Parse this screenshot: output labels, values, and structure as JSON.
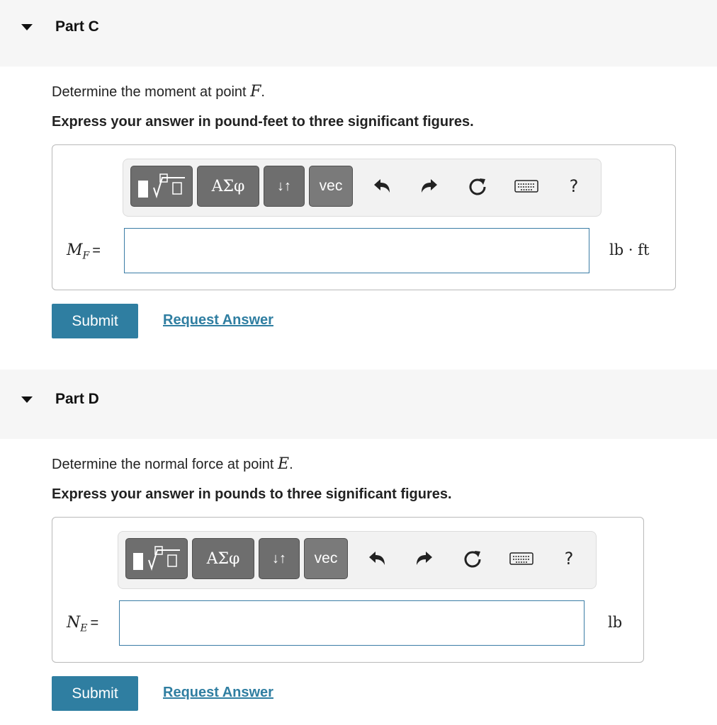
{
  "parts": [
    {
      "title": "Part C",
      "question_prefix": "Determine the moment at point ",
      "question_var": "F",
      "question_suffix": ".",
      "instruction": "Express your answer in pound-feet to three significant figures.",
      "variable": "M",
      "variable_sub": "F",
      "equals": "=",
      "input_value": "",
      "unit": "lb · ft",
      "submit_label": "Submit",
      "request_label": "Request Answer"
    },
    {
      "title": "Part D",
      "question_prefix": "Determine the normal force at point ",
      "question_var": "E",
      "question_suffix": ".",
      "instruction": "Express your answer in pounds to three significant figures.",
      "variable": "N",
      "variable_sub": "E",
      "equals": "=",
      "input_value": "",
      "unit": "lb",
      "submit_label": "Submit",
      "request_label": "Request Answer"
    }
  ],
  "toolbar": {
    "greek_label": "ΑΣφ",
    "arrows_label": "↓↑",
    "vec_label": "vec",
    "help_label": "?",
    "icons": [
      "templates-icon",
      "undo-icon",
      "redo-icon",
      "reset-icon",
      "keyboard-icon",
      "help-icon"
    ]
  },
  "colors": {
    "accent": "#2f7ea1",
    "header_bg": "#f6f6f6",
    "toolbar_button": "#6e6e6e",
    "input_border": "#3a7ca5"
  }
}
